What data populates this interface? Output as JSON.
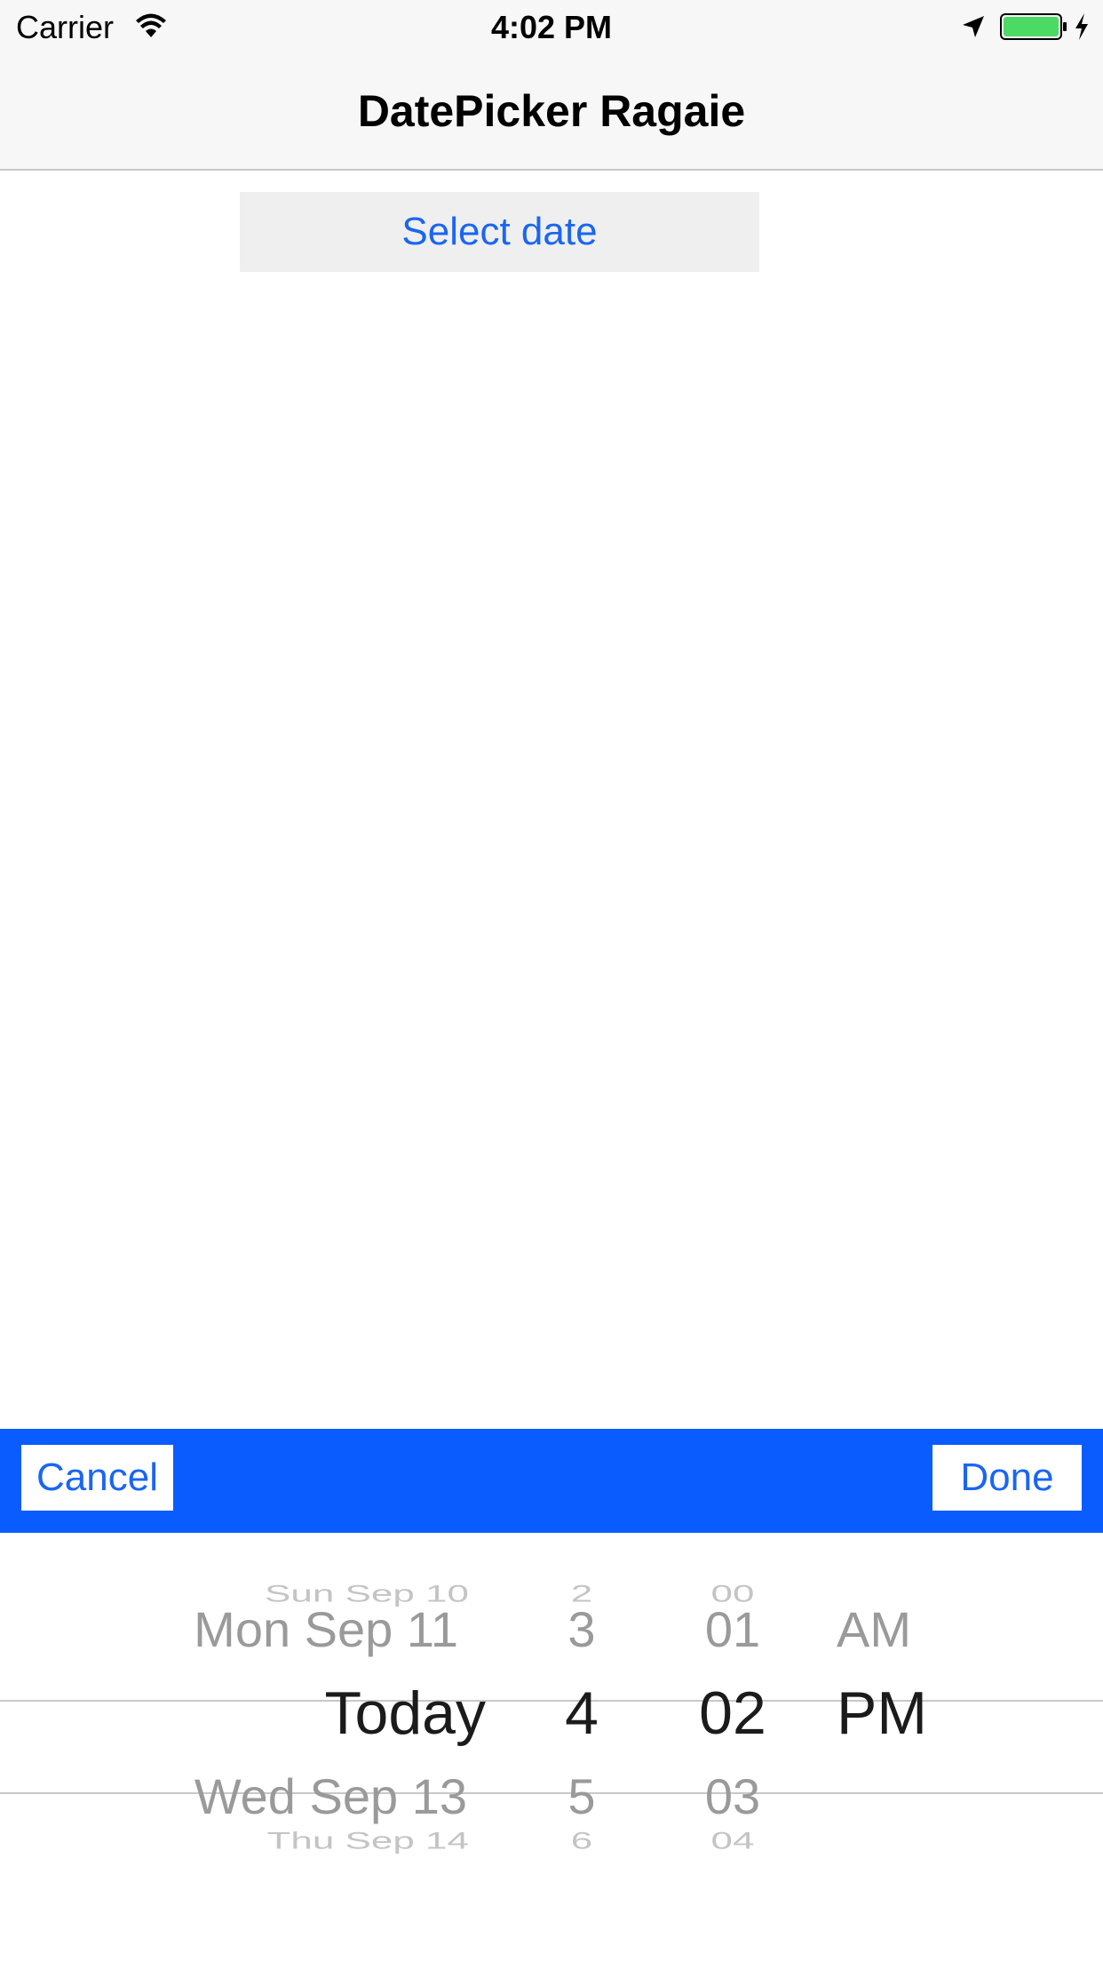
{
  "status_bar": {
    "carrier": "Carrier",
    "time": "4:02 PM",
    "battery_color": "#4cd964"
  },
  "nav": {
    "title": "DatePicker Ragaie"
  },
  "main": {
    "select_date_label": "Select date",
    "accent_color": "#1a66f0"
  },
  "toolbar": {
    "background": "#0a5cff",
    "cancel_label": "Cancel",
    "done_label": "Done"
  },
  "picker": {
    "date_column": [
      "Sun Sep 10",
      "Mon Sep 11",
      "Today",
      "Wed Sep 13",
      "Thu Sep 14"
    ],
    "hour_column": [
      "2",
      "3",
      "4",
      "5",
      "6"
    ],
    "minute_column": [
      "00",
      "01",
      "02",
      "03",
      "04"
    ],
    "ampm_column": [
      "",
      "AM",
      "PM",
      "",
      ""
    ],
    "selected": {
      "date": "Today",
      "hour": "4",
      "minute": "02",
      "ampm": "PM"
    }
  }
}
